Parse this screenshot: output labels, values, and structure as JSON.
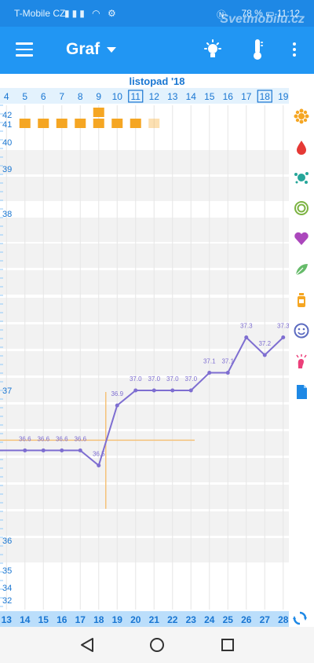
{
  "status_bar": {
    "carrier": "T-Mobile CZ",
    "battery": "78 %",
    "time": "11:12",
    "watermark": "Svetmobilu.cz"
  },
  "app_bar": {
    "title": "Graf",
    "menu_icon": "hamburger-menu-icon",
    "bulb_icon": "lightbulb-icon",
    "thermo_icon": "thermometer-icon",
    "more_icon": "more-vert-icon"
  },
  "colors": {
    "primary": "#2196f3",
    "status_bar": "#1e88e5",
    "accent_orange": "#f5a623",
    "line": "#7e6ed1",
    "axis_text": "#1976d2",
    "crosshair": "#f5c27a"
  },
  "chart_data": {
    "type": "line",
    "month_label": "listopad '18",
    "top_axis_days": [
      "4",
      "5",
      "6",
      "7",
      "8",
      "9",
      "10",
      "11",
      "12",
      "13",
      "14",
      "15",
      "16",
      "17",
      "18",
      "19"
    ],
    "top_axis_boxed": [
      "11",
      "18"
    ],
    "bottom_axis_days": [
      "13",
      "14",
      "15",
      "16",
      "17",
      "18",
      "19",
      "20",
      "21",
      "22",
      "23",
      "24",
      "25",
      "26",
      "27",
      "28"
    ],
    "y_ticks": [
      "42",
      "41",
      "40",
      "39",
      "38",
      "37",
      "36",
      "35",
      "34",
      "32"
    ],
    "series": [
      {
        "values": [
          36.6,
          36.6,
          36.6,
          36.6,
          36.5,
          36.9,
          37.0,
          37.0,
          37.0,
          37.0,
          37.1,
          37.1,
          37.3,
          37.2,
          37.3
        ],
        "labels": [
          "36.6",
          "36.6",
          "36.6",
          "36.6",
          "36.5",
          "36.9",
          "37.0",
          "37.0",
          "37.0",
          "37.0",
          "37.1",
          "37.1",
          "37.3",
          "37.2",
          "37.3"
        ],
        "x_days": [
          "14",
          "15",
          "16",
          "17",
          "18",
          "19",
          "20",
          "21",
          "22",
          "23",
          "24",
          "25",
          "26",
          "27",
          "28"
        ]
      }
    ],
    "coverline": 36.6,
    "ovulation_day": "18",
    "period_bars": [
      {
        "day": "5",
        "fill": 1.0
      },
      {
        "day": "6",
        "fill": 1.0
      },
      {
        "day": "7",
        "fill": 1.0
      },
      {
        "day": "8",
        "fill": 1.0
      },
      {
        "day": "9",
        "fill": 1.0
      },
      {
        "day": "10",
        "fill": 1.0
      },
      {
        "day": "11",
        "fill": 1.0
      },
      {
        "day": "12",
        "fill": 0.4
      }
    ]
  },
  "side_icons": [
    "sun-flower-icon",
    "blood-drop-icon",
    "splash-icon",
    "cervix-icon",
    "heart-icon",
    "leaf-icon",
    "medicine-bottle-icon",
    "smiley-icon",
    "pain-icon",
    "note-icon"
  ],
  "sync_icon": "sync-icon",
  "nav_icons": [
    "back-icon",
    "home-icon",
    "recents-icon"
  ]
}
